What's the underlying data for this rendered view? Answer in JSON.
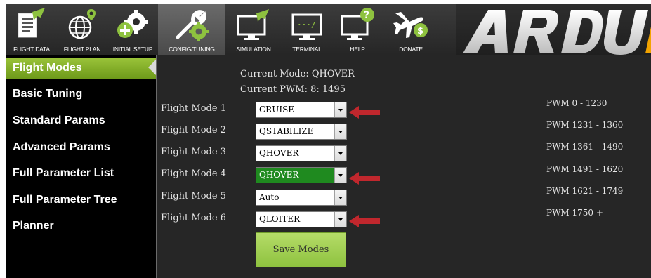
{
  "toolbar": {
    "buttons": [
      {
        "label": "FLIGHT DATA",
        "icon": "flight-data-icon"
      },
      {
        "label": "FLIGHT PLAN",
        "icon": "flight-plan-icon"
      },
      {
        "label": "INITIAL SETUP",
        "icon": "initial-setup-icon"
      },
      {
        "label": "CONFIG/TUNING",
        "icon": "config-tuning-icon",
        "active": true
      },
      {
        "label": "SIMULATION",
        "icon": "simulation-icon"
      },
      {
        "label": "TERMINAL",
        "icon": "terminal-icon"
      },
      {
        "label": "HELP",
        "icon": "help-icon"
      },
      {
        "label": "DONATE",
        "icon": "donate-icon"
      }
    ],
    "brand_text": "ARDUP"
  },
  "sidebar": {
    "items": [
      {
        "label": "Flight Modes",
        "active": true
      },
      {
        "label": "Basic Tuning"
      },
      {
        "label": "Standard Params"
      },
      {
        "label": "Advanced Params"
      },
      {
        "label": "Full Parameter List"
      },
      {
        "label": "Full Parameter Tree"
      },
      {
        "label": "Planner"
      }
    ]
  },
  "status": {
    "current_mode": "Current Mode: QHOVER",
    "current_pwm": "Current PWM:  8: 1495"
  },
  "flight_modes": [
    {
      "label": "Flight Mode 1",
      "value": "CRUISE",
      "marked": true
    },
    {
      "label": "Flight Mode 2",
      "value": "QSTABILIZE"
    },
    {
      "label": "Flight Mode 3",
      "value": "QHOVER"
    },
    {
      "label": "Flight Mode 4",
      "value": "QHOVER",
      "highlighted": true,
      "marked": true
    },
    {
      "label": "Flight Mode 5",
      "value": "Auto"
    },
    {
      "label": "Flight Mode 6",
      "value": "QLOITER",
      "marked": true
    }
  ],
  "pwm_ranges": [
    "PWM 0 - 1230",
    "PWM 1231 - 1360",
    "PWM 1361 - 1490",
    "PWM 1491 - 1620",
    "PWM 1621 - 1749",
    "PWM 1750 +"
  ],
  "save_label": "Save Modes",
  "colors": {
    "accent_green": "#8ec23f",
    "highlight_green": "#1f8a1f",
    "marker_red": "#c0272d",
    "panel_bg": "#262626"
  }
}
